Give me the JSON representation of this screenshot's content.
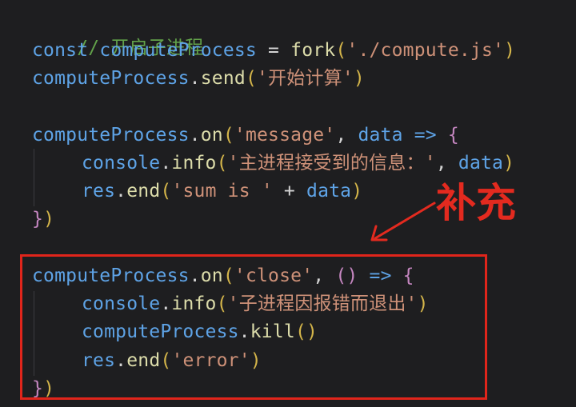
{
  "code": {
    "comment": "// 开启子进程",
    "line2": {
      "kw": "const",
      "var": "computeProcess",
      "eq": " = ",
      "fn": "fork",
      "open": "(",
      "str": "'./compute.js'",
      "close": ")"
    },
    "line3": {
      "var": "computeProcess",
      "dot": ".",
      "fn": "send",
      "open": "(",
      "str": "'开始计算'",
      "close": ")"
    },
    "line5": {
      "var": "computeProcess",
      "dot": ".",
      "fn": "on",
      "open": "(",
      "str": "'message'",
      "comma": ", ",
      "param": "data",
      "arrow": " => ",
      "brace": "{"
    },
    "line6": {
      "obj": "console",
      "dot": ".",
      "fn": "info",
      "open": "(",
      "str": "'主进程接受到的信息：'",
      "comma": ", ",
      "param": "data",
      "close": ")"
    },
    "line7": {
      "obj": "res",
      "dot": ".",
      "fn": "end",
      "open": "(",
      "str": "'sum is '",
      "plus": " + ",
      "param": "data",
      "close": ")"
    },
    "line8": {
      "brace": "}",
      "close": ")"
    },
    "line10": {
      "var": "computeProcess",
      "dot": ".",
      "fn": "on",
      "open": "(",
      "str": "'close'",
      "comma": ", ",
      "parens": "()",
      "arrow": " => ",
      "brace": "{"
    },
    "line11": {
      "obj": "console",
      "dot": ".",
      "fn": "info",
      "open": "(",
      "str": "'子进程因报错而退出'",
      "close": ")"
    },
    "line12": {
      "var": "computeProcess",
      "dot": ".",
      "fn": "kill",
      "parens": "()"
    },
    "line13": {
      "obj": "res",
      "dot": ".",
      "fn": "end",
      "open": "(",
      "str": "'error'",
      "close": ")"
    },
    "line14": {
      "brace": "}",
      "close": ")"
    }
  },
  "annotation": {
    "label": "补充",
    "color": "#e32a1f"
  },
  "colors": {
    "background": "#1e1e20",
    "comment": "#62a24a",
    "keyword": "#5ea3e6",
    "function": "#dcdcaa",
    "string": "#ce9178",
    "highlight_box": "#e0251b"
  }
}
